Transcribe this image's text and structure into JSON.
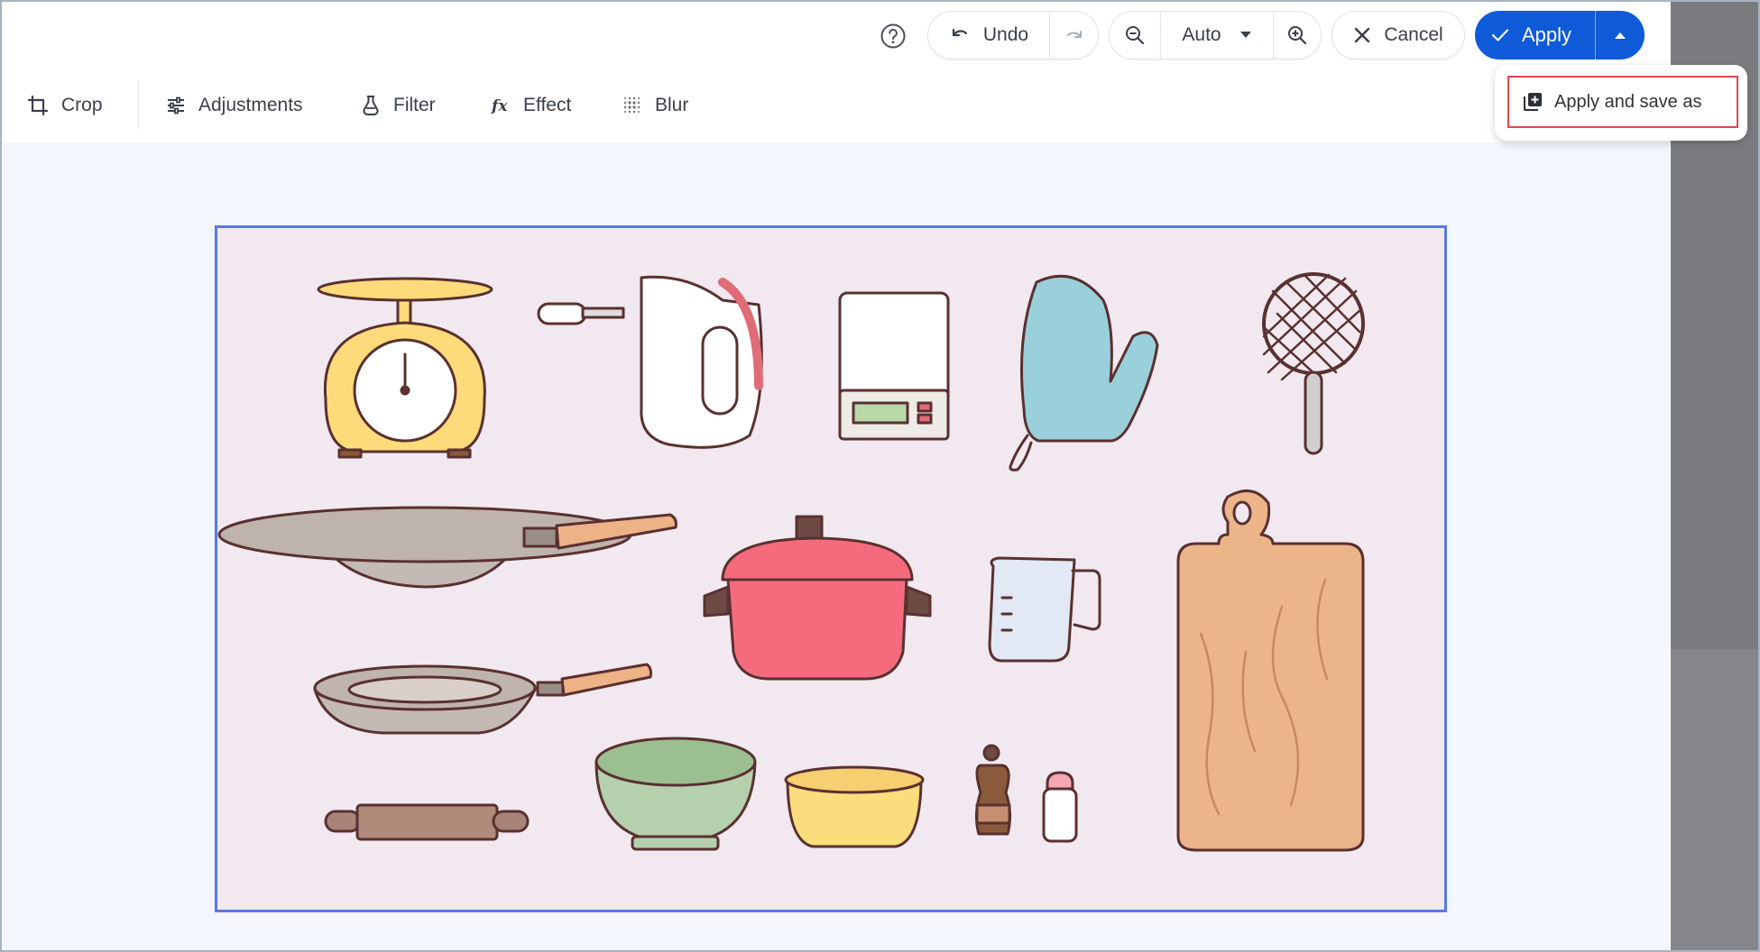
{
  "toolbar": {
    "help_icon": "question-circle-icon",
    "undo_label": "Undo",
    "redo_icon": "redo-icon",
    "zoom_out_icon": "zoom-out-icon",
    "zoom_value": "Auto",
    "zoom_in_icon": "zoom-in-icon",
    "cancel_label": "Cancel",
    "apply_label": "Apply",
    "apply_menu_icon": "caret-up-icon"
  },
  "tools": [
    {
      "label": "Crop",
      "icon": "crop-icon"
    },
    {
      "label": "Adjustments",
      "icon": "sliders-icon"
    },
    {
      "label": "Filter",
      "icon": "filter-flask-icon"
    },
    {
      "label": "Effect",
      "icon": "fx-icon"
    },
    {
      "label": "Blur",
      "icon": "blur-icon"
    }
  ],
  "apply_menu": {
    "items": [
      {
        "label": "Apply and save as",
        "icon": "copy-add-icon"
      }
    ]
  },
  "colors": {
    "primary": "#0e5ad9",
    "selection_border": "#5a78e6",
    "highlight": "#e0474c",
    "canvas_bg": "#f3f6fd",
    "image_bg": "#f1e9ef"
  },
  "image": {
    "subject": "kitchen utensils illustration"
  }
}
